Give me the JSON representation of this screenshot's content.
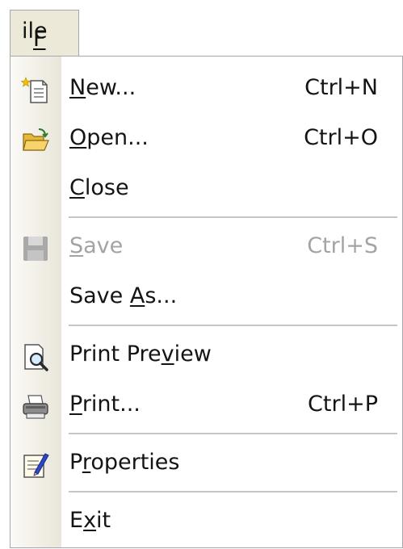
{
  "menu": {
    "title": "File",
    "items": [
      {
        "key": "new",
        "label": "New...",
        "shortcut": "Ctrl+N",
        "icon": "new-document-icon",
        "enabled": true
      },
      {
        "key": "open",
        "label": "Open...",
        "shortcut": "Ctrl+O",
        "icon": "open-folder-icon",
        "enabled": true
      },
      {
        "key": "close",
        "label": "Close",
        "shortcut": "",
        "icon": "",
        "enabled": true
      },
      {
        "key": "save",
        "label": "Save",
        "shortcut": "Ctrl+S",
        "icon": "save-disk-icon",
        "enabled": false
      },
      {
        "key": "save-as",
        "label": "Save As...",
        "shortcut": "",
        "icon": "",
        "enabled": true
      },
      {
        "key": "print-preview",
        "label": "Print Preview",
        "shortcut": "",
        "icon": "print-preview-icon",
        "enabled": true
      },
      {
        "key": "print",
        "label": "Print...",
        "shortcut": "Ctrl+P",
        "icon": "printer-icon",
        "enabled": true
      },
      {
        "key": "properties",
        "label": "Properties",
        "shortcut": "",
        "icon": "properties-icon",
        "enabled": true
      },
      {
        "key": "exit",
        "label": "Exit",
        "shortcut": "",
        "icon": "",
        "enabled": true
      }
    ]
  },
  "colors": {
    "menu_bg": "#ece9d8",
    "gutter": "#e9e6d9",
    "text": "#141414",
    "disabled_text": "#a3a3a3",
    "separator": "#c5c5c5"
  }
}
